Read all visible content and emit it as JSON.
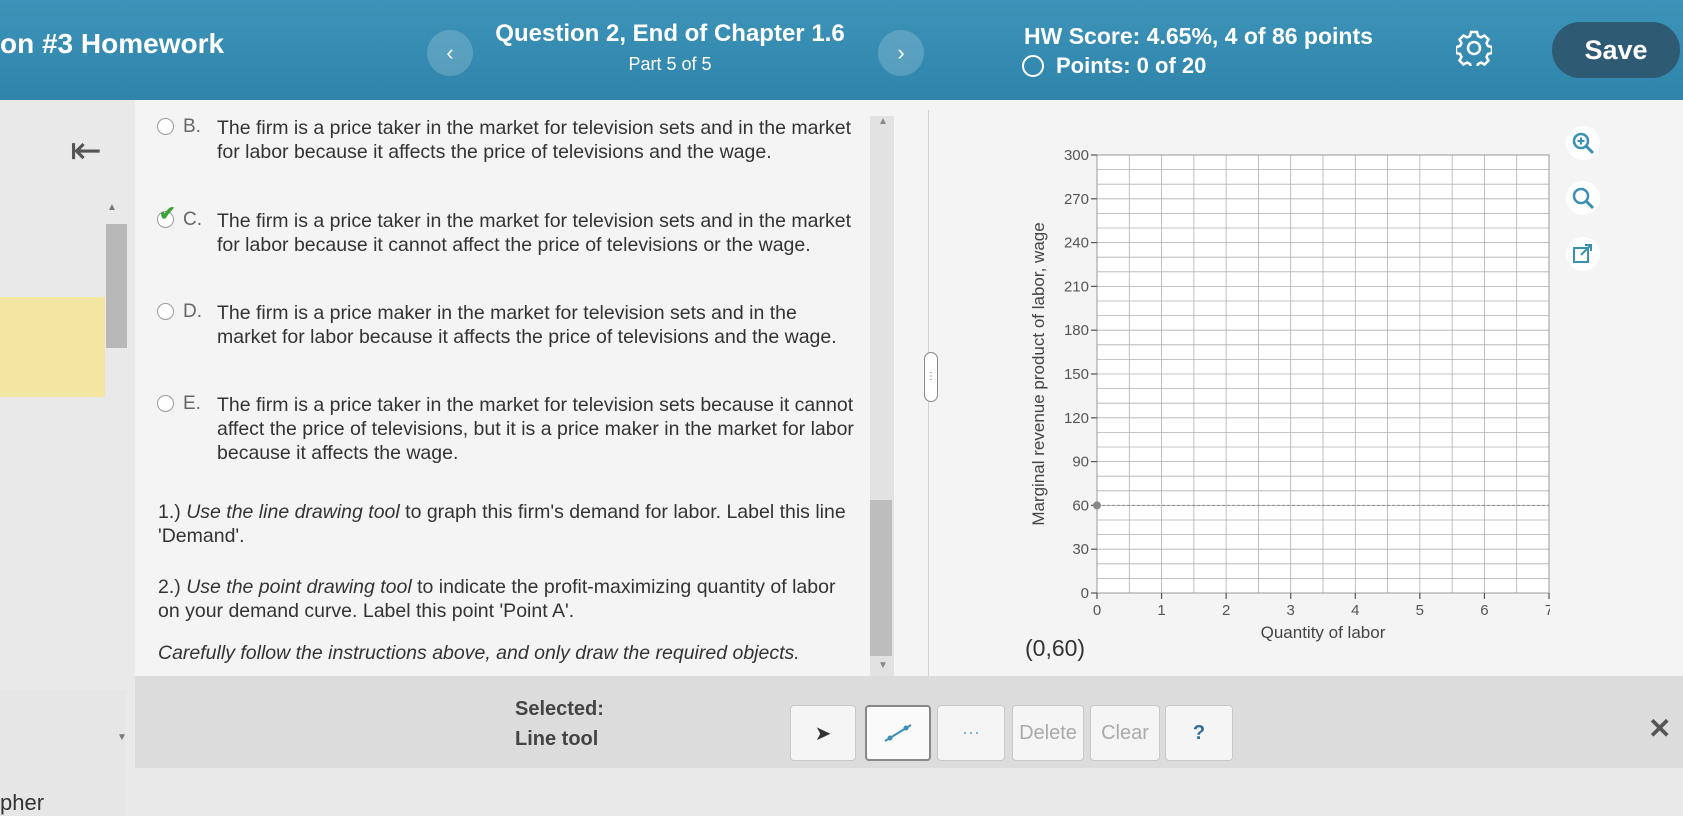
{
  "header": {
    "assignment_title": "on #3 Homework",
    "question_title": "Question 2, End of Chapter 1.6",
    "question_part": "Part 5 of 5",
    "hw_score": "HW Score: 4.65%, 4 of 86 points",
    "points": "Points: 0 of 20",
    "prev_icon": "chevron-left-icon",
    "next_icon": "chevron-right-icon",
    "save_label": "Save"
  },
  "options": [
    {
      "letter": "B.",
      "text": "The firm is a price taker in the market for television sets and in the market for labor because it affects the price of televisions and the wage.",
      "checked": false
    },
    {
      "letter": "C.",
      "text": "The firm is a price taker in the market for television sets and in the market for labor because it cannot affect the price of televisions or the wage.",
      "checked": true
    },
    {
      "letter": "D.",
      "text": "The firm is a price maker in the market for television sets and in the market for labor because it affects the price of televisions and the wage.",
      "checked": false
    },
    {
      "letter": "E.",
      "text": "The firm is a price taker in the market for television sets because it cannot affect the price of televisions, but it is a price maker in the market for labor because it affects the wage.",
      "checked": false
    }
  ],
  "instructions": {
    "step1_prefix": "1.) ",
    "step1_italic": "Use the line drawing tool",
    "step1_rest": " to graph this firm's demand for labor. Label this line 'Demand'.",
    "step2_prefix": "2.) ",
    "step2_italic": "Use the point drawing tool",
    "step2_rest": " to indicate the profit-maximizing quantity of labor on your demand curve. Label this point 'Point A'.",
    "note": "Carefully follow the instructions above, and only draw the required objects."
  },
  "chart_data": {
    "type": "line",
    "xlabel": "Quantity of labor",
    "ylabel": "Marginal revenue product of labor, wage",
    "xlim": [
      0,
      7
    ],
    "ylim": [
      0,
      300
    ],
    "x_ticks": [
      0,
      1,
      2,
      3,
      4,
      5,
      6,
      7
    ],
    "y_ticks": [
      0,
      30,
      60,
      90,
      120,
      150,
      180,
      210,
      240,
      270,
      300
    ],
    "grid": true,
    "cursor_point": {
      "x": 0,
      "y": 60
    },
    "cursor_hline_y": 60
  },
  "coordinate_readout": "(0,60)",
  "toolbar": {
    "selected_label": "Selected:",
    "selected_tool": "Line tool",
    "delete_label": "Delete",
    "clear_label": "Clear",
    "help_label": "?"
  },
  "footer_text": "pher",
  "colors": {
    "header_bg": "#3391b8",
    "save_bg": "#2e5a73",
    "check": "#3aa33a"
  }
}
